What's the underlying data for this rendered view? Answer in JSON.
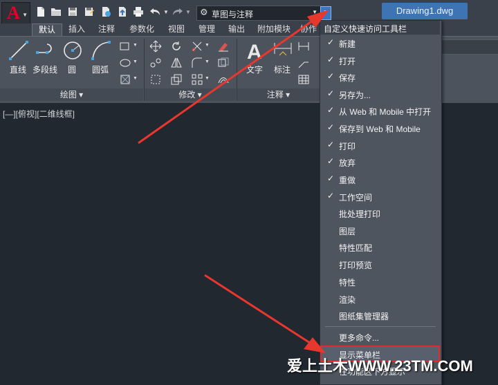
{
  "titlebar": {
    "app_logo": "A",
    "workspace": "草图与注释",
    "document_title": "Drawing1.dwg"
  },
  "ribbon": {
    "tabs": [
      "默认",
      "插入",
      "注释",
      "参数化",
      "视图",
      "管理",
      "输出",
      "附加模块",
      "协作"
    ],
    "active_tab": "默认",
    "draw_tools": [
      "直线",
      "多段线",
      "圆",
      "圆弧"
    ],
    "annotate_tools": [
      "文字",
      "标注"
    ],
    "panels": [
      "绘图 ▾",
      "修改 ▾",
      "注释 ▾"
    ]
  },
  "viewport": {
    "label": "[—][俯视][二维线框]"
  },
  "menu": {
    "title": "自定义快速访问工具栏",
    "items": [
      {
        "label": "新建",
        "check": "✓"
      },
      {
        "label": "打开",
        "check": "✓"
      },
      {
        "label": "保存",
        "check": "✓"
      },
      {
        "label": "另存为...",
        "check": "✓"
      },
      {
        "label": "从 Web 和 Mobile 中打开",
        "check": "✓"
      },
      {
        "label": "保存到 Web 和 Mobile",
        "check": "✓"
      },
      {
        "label": "打印",
        "check": "✓"
      },
      {
        "label": "放弃",
        "check": "✓"
      },
      {
        "label": "重做",
        "check": "✓"
      },
      {
        "label": "工作空间",
        "check": "✓"
      },
      {
        "label": "批处理打印",
        "check": ""
      },
      {
        "label": "图层",
        "check": ""
      },
      {
        "label": "特性匹配",
        "check": ""
      },
      {
        "label": "打印预览",
        "check": ""
      },
      {
        "label": "特性",
        "check": ""
      },
      {
        "label": "渲染",
        "check": ""
      },
      {
        "label": "图纸集管理器",
        "check": ""
      },
      {
        "label": "更多命令...",
        "check": ""
      },
      {
        "label": "显示菜单栏",
        "check": ""
      },
      {
        "label": "在功能区下方显示",
        "check": ""
      }
    ]
  },
  "watermark": "爱上土木WWW.23TM.COM",
  "colors": {
    "accent_blue": "#3f74b4",
    "highlight_red": "#e02c2c",
    "arrow_red": "#e8372d",
    "logo_red": "#e4002b"
  }
}
